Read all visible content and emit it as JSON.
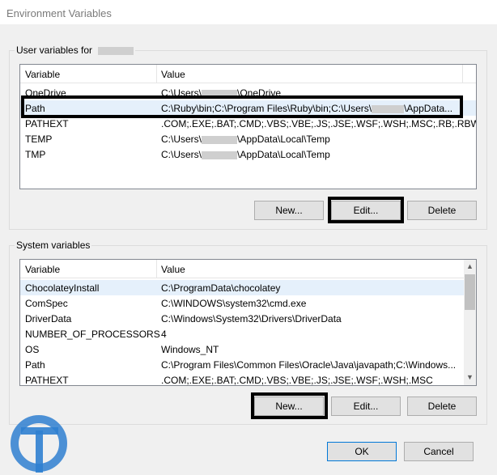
{
  "window": {
    "title": "Environment Variables"
  },
  "user_section": {
    "label": "User variables for",
    "columns": [
      "Variable",
      "Value"
    ],
    "rows": [
      {
        "variable": "OneDrive",
        "value_prefix": "C:\\Users\\",
        "value_suffix": "\\OneDrive"
      },
      {
        "variable": "Path",
        "value_prefix": "C:\\Ruby\\bin;C:\\Program Files\\Ruby\\bin;C:\\Users\\",
        "value_suffix": "\\AppData..."
      },
      {
        "variable": "PATHEXT",
        "value_prefix": ".COM;.EXE;.BAT;.CMD;.VBS;.VBE;.JS;.JSE;.WSF;.WSH;.MSC;.RB;.RBW;...",
        "value_suffix": ""
      },
      {
        "variable": "TEMP",
        "value_prefix": "C:\\Users\\",
        "value_suffix": "\\AppData\\Local\\Temp"
      },
      {
        "variable": "TMP",
        "value_prefix": "C:\\Users\\",
        "value_suffix": "\\AppData\\Local\\Temp"
      }
    ],
    "buttons": {
      "new": "New...",
      "edit": "Edit...",
      "delete": "Delete"
    }
  },
  "system_section": {
    "label": "System variables",
    "columns": [
      "Variable",
      "Value"
    ],
    "rows": [
      {
        "variable": "ChocolateyInstall",
        "value": "C:\\ProgramData\\chocolatey"
      },
      {
        "variable": "ComSpec",
        "value": "C:\\WINDOWS\\system32\\cmd.exe"
      },
      {
        "variable": "DriverData",
        "value": "C:\\Windows\\System32\\Drivers\\DriverData"
      },
      {
        "variable": "NUMBER_OF_PROCESSORS",
        "value": "4"
      },
      {
        "variable": "OS",
        "value": "Windows_NT"
      },
      {
        "variable": "Path",
        "value": "C:\\Program Files\\Common Files\\Oracle\\Java\\javapath;C:\\Windows..."
      },
      {
        "variable": "PATHEXT",
        "value": ".COM;.EXE;.BAT;.CMD;.VBS;.VBE;.JS;.JSE;.WSF;.WSH;.MSC"
      }
    ],
    "buttons": {
      "new": "New...",
      "edit": "Edit...",
      "delete": "Delete"
    }
  },
  "dialog_buttons": {
    "ok": "OK",
    "cancel": "Cancel"
  },
  "colors": {
    "selection": "#e5f0fb",
    "highlight_border": "#000000",
    "default_button_border": "#0078d7",
    "logo": "#2f7fd0"
  },
  "icons": {
    "scroll_up": "up-arrow-icon",
    "scroll_down": "down-arrow-icon",
    "logo": "logo-icon"
  }
}
